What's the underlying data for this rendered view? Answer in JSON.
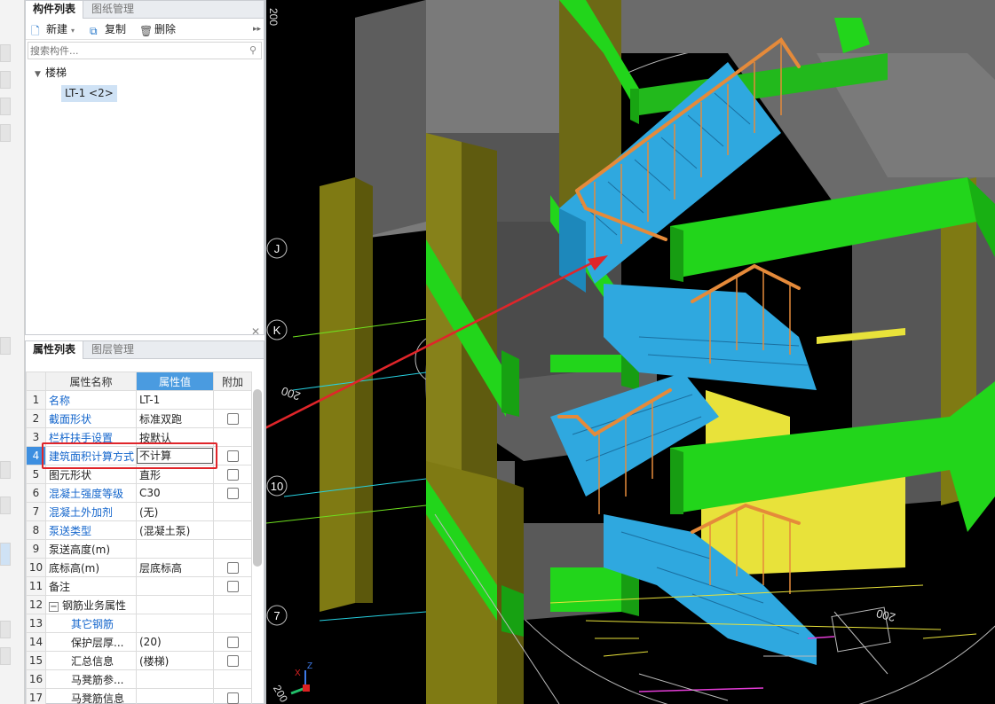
{
  "component_panel": {
    "tabs": [
      {
        "label": "构件列表",
        "active": true
      },
      {
        "label": "图纸管理",
        "active": false
      }
    ],
    "toolbar": {
      "new_label": "新建",
      "copy_label": "复制",
      "delete_label": "删除"
    },
    "search": {
      "placeholder": "搜索构件..."
    },
    "tree": {
      "root_label": "楼梯",
      "items": [
        {
          "label": "LT-1 <2>",
          "selected": true
        }
      ]
    }
  },
  "property_panel": {
    "tabs": [
      {
        "label": "属性列表",
        "active": true
      },
      {
        "label": "图层管理",
        "active": false
      }
    ],
    "columns": {
      "name": "属性名称",
      "value": "属性值",
      "extra": "附加"
    },
    "rows": [
      {
        "num": "1",
        "name": "名称",
        "value": "LT-1",
        "checkbox": false,
        "blue": true
      },
      {
        "num": "2",
        "name": "截面形状",
        "value": "标准双跑",
        "checkbox": true,
        "blue": true
      },
      {
        "num": "3",
        "name": "栏杆扶手设置",
        "value": "按默认",
        "checkbox": false,
        "blue": true
      },
      {
        "num": "4",
        "name": "建筑面积计算方式",
        "value": "不计算",
        "checkbox": true,
        "blue": true,
        "editing": true
      },
      {
        "num": "5",
        "name": "图元形状",
        "value": "直形",
        "checkbox": true,
        "blue": false
      },
      {
        "num": "6",
        "name": "混凝土强度等级",
        "value": "C30",
        "checkbox": true,
        "blue": true
      },
      {
        "num": "7",
        "name": "混凝土外加剂",
        "value": "(无)",
        "checkbox": false,
        "blue": true
      },
      {
        "num": "8",
        "name": "泵送类型",
        "value": "(混凝土泵)",
        "checkbox": false,
        "blue": true
      },
      {
        "num": "9",
        "name": "泵送高度(m)",
        "value": "",
        "checkbox": false,
        "blue": false
      },
      {
        "num": "10",
        "name": "底标高(m)",
        "value": "层底标高",
        "checkbox": true,
        "blue": false
      },
      {
        "num": "11",
        "name": "备注",
        "value": "",
        "checkbox": true,
        "blue": false
      },
      {
        "num": "12",
        "name": "钢筋业务属性",
        "value": "",
        "checkbox": false,
        "blue": false,
        "group": true
      },
      {
        "num": "13",
        "name": "其它钢筋",
        "value": "",
        "checkbox": false,
        "blue": true,
        "sub": true
      },
      {
        "num": "14",
        "name": "保护层厚...",
        "value": "(20)",
        "checkbox": true,
        "blue": false,
        "sub": true
      },
      {
        "num": "15",
        "name": "汇总信息",
        "value": "(楼梯)",
        "checkbox": true,
        "blue": false,
        "sub": true
      },
      {
        "num": "16",
        "name": "马凳筋参...",
        "value": "",
        "checkbox": false,
        "blue": false,
        "sub": true
      },
      {
        "num": "17",
        "name": "马凳筋信息",
        "value": "",
        "checkbox": true,
        "blue": false,
        "sub": true
      }
    ]
  },
  "viewport": {
    "axis_labels": [
      "J",
      "K",
      "10",
      "7"
    ],
    "dim_labels": [
      "200",
      "200",
      "200",
      "200"
    ],
    "axis_gizmo": {
      "x": "X",
      "z": "Z"
    },
    "colors": {
      "background": "#000000",
      "wall_gray": "#6e6e6e",
      "beam_green": "#22d51b",
      "stair_blue": "#2fa8df",
      "railing_orange": "#e58a3a",
      "yellow_wall": "#e8e23a",
      "olive_wall": "#7f7a13",
      "callout_red": "#e0252a"
    }
  }
}
